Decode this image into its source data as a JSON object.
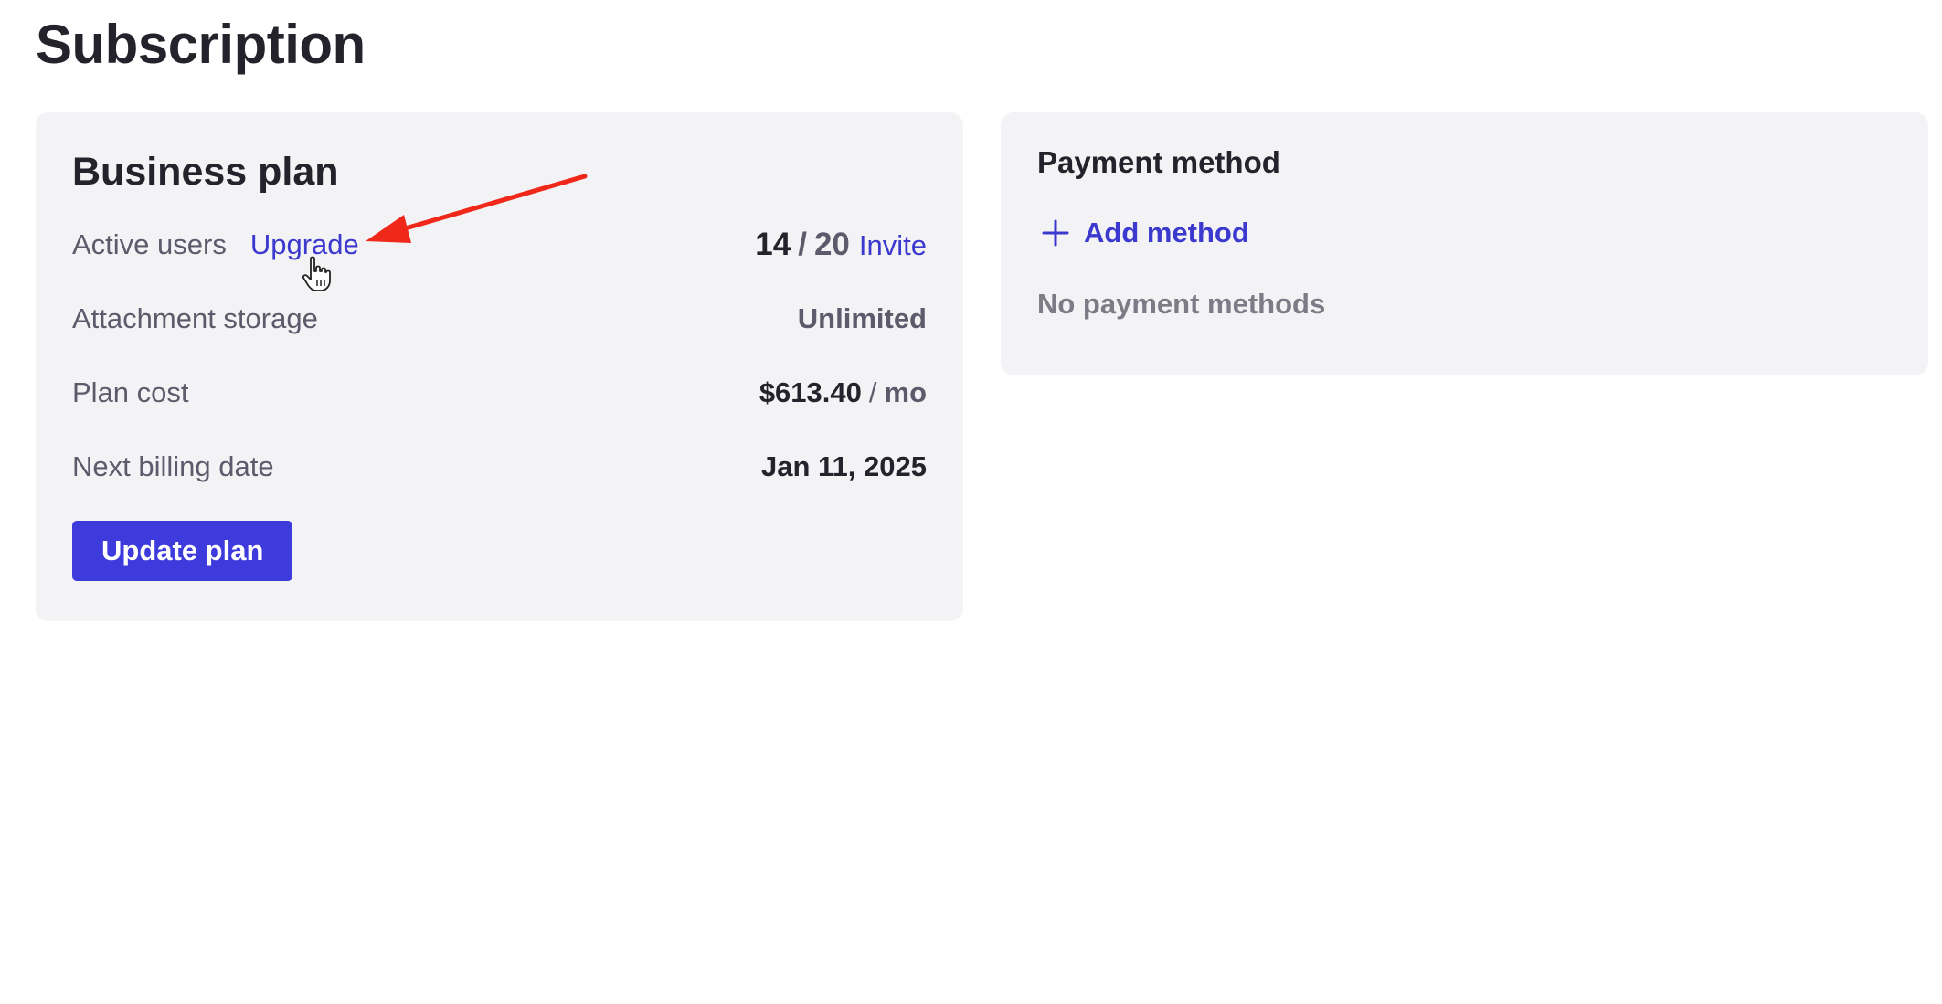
{
  "page": {
    "title": "Subscription"
  },
  "plan_card": {
    "title": "Business plan",
    "active_users": {
      "label": "Active users",
      "upgrade_link": "Upgrade",
      "count": "14",
      "separator": "/",
      "total": "20",
      "invite_link": "Invite"
    },
    "storage": {
      "label": "Attachment storage",
      "value": "Unlimited"
    },
    "cost": {
      "label": "Plan cost",
      "amount": "$613.40",
      "separator": "/",
      "unit": "mo"
    },
    "billing": {
      "label": "Next billing date",
      "value": "Jan 11, 2025"
    },
    "update_button": "Update plan"
  },
  "payment_card": {
    "title": "Payment method",
    "add_method": "Add method",
    "empty_text": "No payment methods"
  },
  "colors": {
    "accent": "#3e3bdc",
    "link": "#3c39cf",
    "card_bg": "#f3f3f5",
    "annotation_arrow": "#f0281a"
  },
  "icons": {
    "add": "plus-icon",
    "annotation": "red-arrow-icon",
    "pointer": "hand-cursor-icon"
  }
}
